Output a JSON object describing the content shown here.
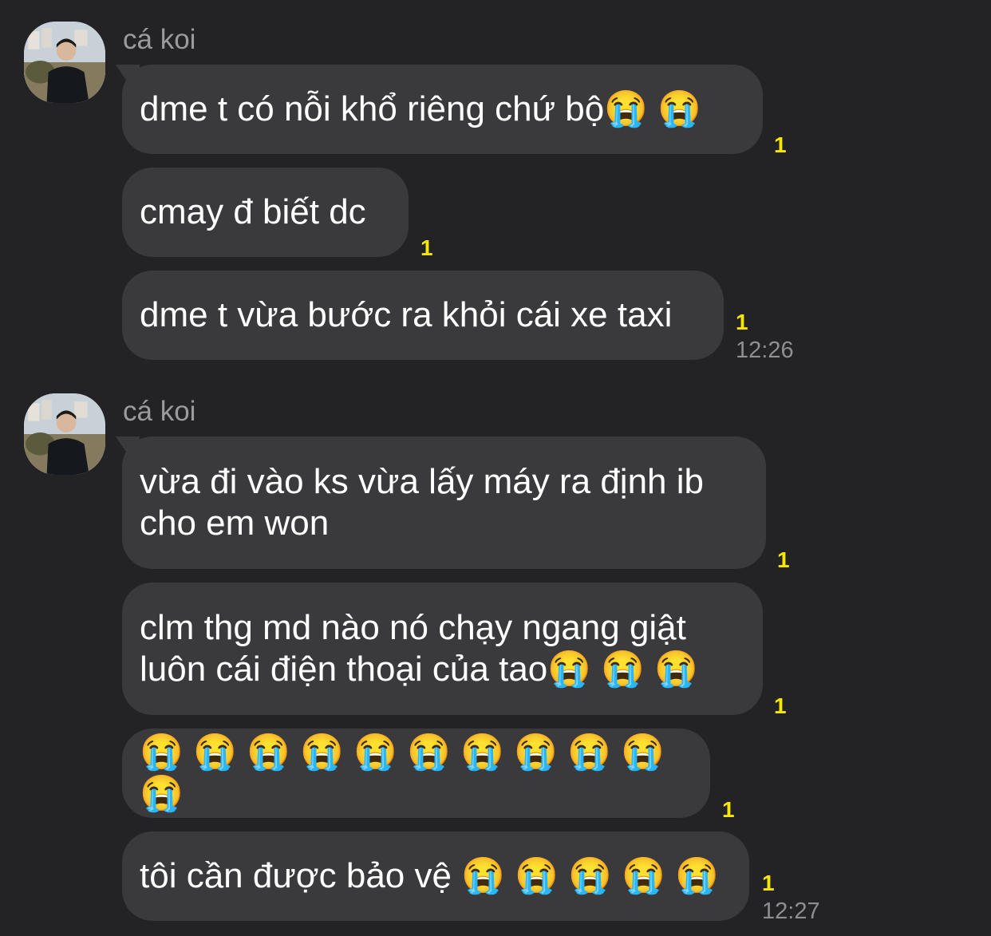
{
  "groups": [
    {
      "sender": "cá koi",
      "time": "12:26",
      "messages": [
        {
          "text": "dme t có nỗi khổ riêng chứ bộ😭 😭",
          "unread": "1"
        },
        {
          "text": "cmay đ biết dc",
          "unread": "1"
        },
        {
          "text": "dme t vừa bước ra khỏi cái xe taxi",
          "unread": "1"
        }
      ]
    },
    {
      "sender": "cá koi",
      "time": "12:27",
      "messages": [
        {
          "text": "vừa đi vào ks vừa lấy máy ra định ib\ncho em won",
          "unread": "1"
        },
        {
          "text": "clm thg md nào nó chạy ngang giật\nluôn cái điện thoại của tao😭 😭 😭",
          "unread": "1"
        },
        {
          "text": "😭 😭 😭 😭 😭 😭 😭 😭 😭 😭 😭",
          "unread": "1"
        },
        {
          "text": "tôi cần được bảo vệ 😭 😭 😭 😭 😭",
          "unread": "1"
        }
      ]
    }
  ]
}
